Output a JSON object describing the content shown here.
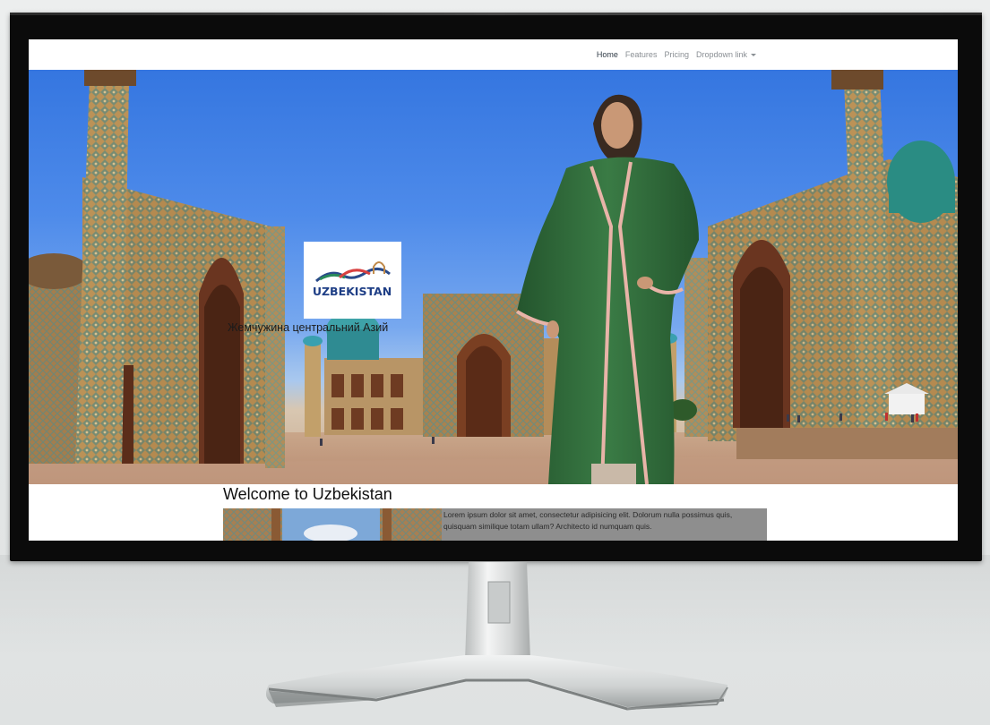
{
  "navbar": {
    "items": [
      {
        "label": "Home",
        "active": true
      },
      {
        "label": "Features",
        "active": false
      },
      {
        "label": "Pricing",
        "active": false
      },
      {
        "label": "Dropdown link",
        "active": false,
        "has_caret": true
      }
    ]
  },
  "hero": {
    "logo_text": "UZBEKISTAN",
    "tagline": "Жемчужина центральний Азий"
  },
  "content": {
    "heading": "Welcome to Uzbekistan",
    "body": "Lorem ipsum dolor sit amet, consectetur adipisicing elit. Dolorum nulla possimus quis, quisquam similique totam ullam? Architecto id numquam quis."
  },
  "colors": {
    "monitor_bezel": "#0b0b0b",
    "sky": "#3576e0",
    "tile_teal": "#2b7c86",
    "robe_green": "#2f6b3b",
    "card_grey": "#8e8e8e"
  }
}
